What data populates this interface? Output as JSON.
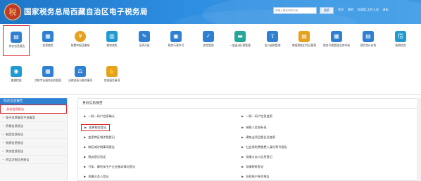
{
  "header": {
    "title": "国家税务总局西藏自治区电子税务局",
    "logo_glyph": "税",
    "search_placeholder": "请输入要查询的内容",
    "search_button": "搜索",
    "links": [
      "首页",
      "我的",
      "欢迎您,工作人员",
      "退出"
    ]
  },
  "menu_items": [
    {
      "label": "综合信息报告",
      "color": "#2f80d1",
      "icon": "document-icon"
    },
    {
      "label": "发票使用",
      "color": "#2f80d1",
      "icon": "invoice-icon"
    },
    {
      "label": "税费申报及缴纳",
      "color": "#e6a11f",
      "icon": "tax-coin-icon"
    },
    {
      "label": "税收减免",
      "color": "#1f9bd1",
      "icon": "reduction-icon"
    },
    {
      "label": "证明开具",
      "color": "#2f80d1",
      "icon": "certificate-icon"
    },
    {
      "label": "税务行政许可",
      "color": "#2f80d1",
      "icon": "permit-icon"
    },
    {
      "label": "核定管理",
      "color": "#2f80d1",
      "icon": "verify-icon"
    },
    {
      "label": "一般退(抵)税管理",
      "color": "#26a59a",
      "icon": "refund-icon"
    },
    {
      "label": "出口退税管理",
      "color": "#2f80d1",
      "icon": "export-icon"
    },
    {
      "label": "增值税抵扣凭证管理",
      "color": "#e6a11f",
      "icon": "voucher-icon"
    },
    {
      "label": "税务代理管理业务申请",
      "color": "#2f80d1",
      "icon": "agent-icon"
    },
    {
      "label": "预约定价安排",
      "color": "#2f80d1",
      "icon": "pricing-icon"
    },
    {
      "label": "纳税信用",
      "color": "#1f9bd1",
      "icon": "credit-icon"
    }
  ],
  "menu_items_row2": [
    {
      "label": "稽查检查",
      "color": "#1f9bd1",
      "icon": "inspect-icon"
    },
    {
      "label": "涉税专业服务机构管理",
      "color": "#2f80d1",
      "icon": "service-icon"
    },
    {
      "label": "法律追责与救济事项",
      "color": "#2f80d1",
      "icon": "law-icon"
    },
    {
      "label": "其他服务事项",
      "color": "#e6a11f",
      "icon": "handshake-icon"
    }
  ],
  "sidebar": {
    "title": "综合信息报告",
    "items": [
      "身份信息报告",
      "电子发票服务平台备案",
      "资格信息报告",
      "制度信息报告",
      "税源信息报告",
      "状态信息报告",
      "特定涉税信息报告"
    ]
  },
  "panel": {
    "title": "身份信息报告",
    "left": [
      "一照一码户信息确认",
      "变更税务登记",
      "变更跨区域涉税登记",
      "跨区域涉税事项报告",
      "税务登记验证",
      "汽车、摩托车生产企业基本情况登记",
      "扣缴义务人登记"
    ],
    "right": [
      "一照一码户信息变更",
      "纳税人信息补录",
      "建筑业项目报告及变更",
      "社会保险费缴费人身份等号报告",
      "扣缴义务人信息登记",
      "扣缴税款登记",
      "存款账户账号报告"
    ]
  }
}
